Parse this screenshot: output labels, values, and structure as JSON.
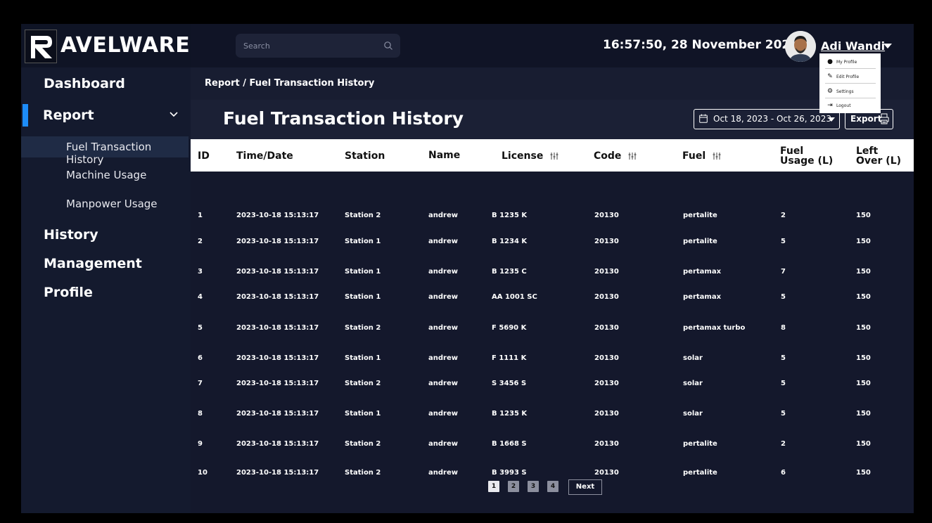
{
  "brand": {
    "name": "AVELWARE"
  },
  "sidebar": {
    "items": [
      {
        "label": "Dashboard"
      },
      {
        "label": "Report",
        "expanded": true,
        "children": [
          {
            "label": "Fuel Transaction History",
            "active": true
          },
          {
            "label": "Machine Usage"
          },
          {
            "label": "Manpower Usage"
          }
        ]
      },
      {
        "label": "History"
      },
      {
        "label": "Management"
      },
      {
        "label": "Profile"
      }
    ]
  },
  "topbar": {
    "search_placeholder": "Search",
    "datetime": "16:57:50, 28 November 2023",
    "user_name": "Adi Wandi"
  },
  "user_menu": {
    "items": [
      {
        "label": "My Profile",
        "icon": "user-icon"
      },
      {
        "label": "Edit Profile",
        "icon": "edit-icon"
      },
      {
        "label": "Settings",
        "icon": "gear-icon"
      },
      {
        "label": "Logout",
        "icon": "logout-icon"
      }
    ]
  },
  "breadcrumb": "Report / Fuel Transaction History",
  "page": {
    "title": "Fuel Transaction History",
    "date_range": "Oct 18, 2023 - Oct 26, 2023",
    "export_label": "Export"
  },
  "table": {
    "headers": {
      "id": "ID",
      "time": "Time/Date",
      "station": "Station",
      "name": "Name",
      "license": "License",
      "code": "Code",
      "fuel": "Fuel",
      "fuel_usage_1": "Fuel",
      "fuel_usage_2": "Usage (L)",
      "left_over_1": "Left",
      "left_over_2": "Over (L)"
    },
    "rows": [
      {
        "id": "1",
        "time": "2023-10-18 15:13:17",
        "station": "Station 2",
        "name": "andrew",
        "license": "B 1235 K",
        "code": "20130",
        "fuel": "pertalite",
        "usage": "2",
        "left": "150"
      },
      {
        "id": "2",
        "time": "2023-10-18 15:13:17",
        "station": "Station 1",
        "name": "andrew",
        "license": "B 1234 K",
        "code": "20130",
        "fuel": "pertalite",
        "usage": "5",
        "left": "150"
      },
      {
        "id": "3",
        "time": "2023-10-18 15:13:17",
        "station": "Station 1",
        "name": "andrew",
        "license": "B 1235 C",
        "code": "20130",
        "fuel": "pertamax",
        "usage": "7",
        "left": "150"
      },
      {
        "id": "4",
        "time": "2023-10-18 15:13:17",
        "station": "Station 1",
        "name": "andrew",
        "license": "AA 1001 SC",
        "code": "20130",
        "fuel": "pertamax",
        "usage": "5",
        "left": "150"
      },
      {
        "id": "5",
        "time": "2023-10-18 15:13:17",
        "station": "Station 2",
        "name": "andrew",
        "license": "F 5690 K",
        "code": "20130",
        "fuel": "pertamax turbo",
        "usage": "8",
        "left": "150"
      },
      {
        "id": "6",
        "time": "2023-10-18 15:13:17",
        "station": "Station 1",
        "name": "andrew",
        "license": "F 1111 K",
        "code": "20130",
        "fuel": "solar",
        "usage": "5",
        "left": "150"
      },
      {
        "id": "7",
        "time": "2023-10-18 15:13:17",
        "station": "Station 2",
        "name": "andrew",
        "license": "S 3456 S",
        "code": "20130",
        "fuel": "solar",
        "usage": "5",
        "left": "150"
      },
      {
        "id": "8",
        "time": "2023-10-18 15:13:17",
        "station": "Station 1",
        "name": "andrew",
        "license": "B 1235 K",
        "code": "20130",
        "fuel": "solar",
        "usage": "5",
        "left": "150"
      },
      {
        "id": "9",
        "time": "2023-10-18 15:13:17",
        "station": "Station 2",
        "name": "andrew",
        "license": "B 1668 S",
        "code": "20130",
        "fuel": "pertalite",
        "usage": "2",
        "left": "150"
      },
      {
        "id": "10",
        "time": "2023-10-18 15:13:17",
        "station": "Station 2",
        "name": "andrew",
        "license": "B 3993 S",
        "code": "20130",
        "fuel": "pertalite",
        "usage": "6",
        "left": "150"
      }
    ]
  },
  "pagination": {
    "pages": [
      "1",
      "2",
      "3",
      "4"
    ],
    "current": "1",
    "next_label": "Next"
  },
  "colors": {
    "accent": "#1d8cf8",
    "sidebar_bg": "#141a2e",
    "content_bg": "#14182c"
  }
}
